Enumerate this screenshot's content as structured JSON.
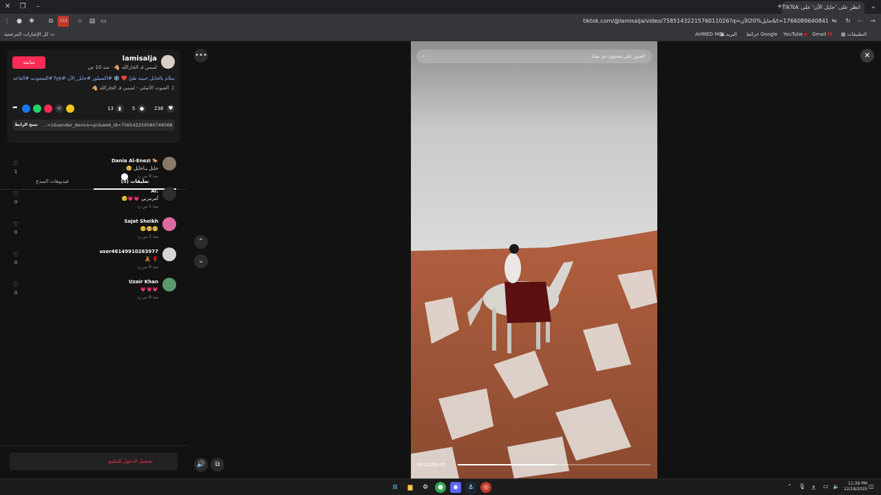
{
  "browser": {
    "tab_title": "انظر على 'حايل الآن' على TikTok",
    "url": "tiktok.com/@lamisalja/video/7585143221576011026?q=حايل%20الآن&t=1766089640841",
    "bookmarks_all": "كل الإشارات المرجعية",
    "bookmarks": [
      "التطبيقات",
      "Gmail",
      "YouTube",
      "خرائط Google",
      "البريد",
      "AHMED MO..."
    ],
    "extension_badge": "333"
  },
  "post": {
    "username": "lamisalja",
    "subtitle": "لميس فـ الجارالله 🐴 · منذ 10 س",
    "follow_label": "متابعة",
    "caption": "سلام يالحايل حبيبة طيّ ❤️ ❄️ #اكسبلور #حايل_الآن #fyp #السعوديه #القاعد",
    "sound": "♫ الصوت الأصلي - لميس فـ الجارالله 🐴",
    "likes": "238",
    "comments_count": "5",
    "saves": "13",
    "link": "...=1&sender_device=pc&web_id=7565422595807495688",
    "copy_link_label": "نسخ الرابط"
  },
  "tabs": {
    "comments": "تعليقات (5)",
    "creator_videos": "فيديوهات المبدع"
  },
  "comments": [
    {
      "name": "🐎 Dania Al-Enezi",
      "text": "حايل يـاحايل 🥺 .",
      "meta": "منذ 9 س    رد",
      "likes": "1",
      "avatar_color": "#8a7a6a"
    },
    {
      "name": ".Al",
      "text": "آمرمرني 💗💗🥺",
      "meta": "منذ 1 س    رد",
      "likes": "0",
      "avatar_color": "#2e2e2e"
    },
    {
      "name": "Sajat Sheikh",
      "text": "🥺🥺🥺",
      "meta": "منذ 3 س    رد",
      "likes": "0",
      "avatar_color": "#e06aa0"
    },
    {
      "name": "user46149910263977",
      "text": "🌹 🧸",
      "meta": "منذ 6 س    رد",
      "likes": "0",
      "avatar_color": "#d6d6d6"
    },
    {
      "name": "Uzair Khan",
      "text": "💗💗💗",
      "meta": "منذ 8 س    رد",
      "likes": "0",
      "avatar_color": "#5c9a6e"
    }
  ],
  "login_prompt": "تسجيل الدخول للتعليق",
  "video": {
    "search_placeholder": "العثور على محتوى ذي صلة",
    "time": "00:23/00:45",
    "progress": 0.51
  },
  "taskbar": {
    "time": "11:39 PM",
    "date": "12/18/2025",
    "lang": "ع"
  },
  "colors": {
    "accent": "#fe2c55",
    "hashtag": "#8ab4ff"
  }
}
